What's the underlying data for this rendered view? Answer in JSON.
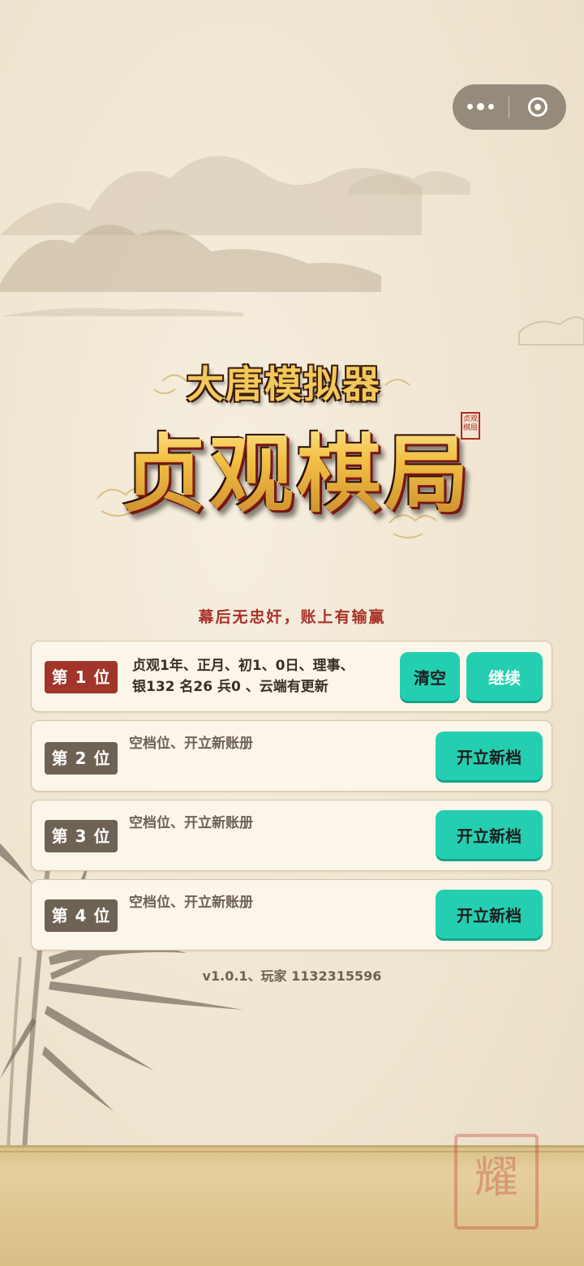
{
  "capsule": {
    "more_icon": "more-dots-icon",
    "close_icon": "target-icon"
  },
  "logo": {
    "subtitle": "大唐模拟器",
    "title": "贞观棋局",
    "stamp": "贞观 棋局"
  },
  "slogan": "幕后无忠奸，账上有输赢",
  "slots": [
    {
      "badge": "第 1 位",
      "line1": "贞观1年、正月、初1、0日、理事、",
      "line2": "银132 名26 兵0 、云端有更新",
      "clear_label": "清空",
      "continue_label": "继续"
    },
    {
      "badge": "第 2 位",
      "text": "空档位、开立新账册",
      "button_label": "开立新档"
    },
    {
      "badge": "第 3 位",
      "text": "空档位、开立新账册",
      "button_label": "开立新档"
    },
    {
      "badge": "第 4 位",
      "text": "空档位、开立新账册",
      "button_label": "开立新档"
    }
  ],
  "footer": "v1.0.1、玩家 1132315596",
  "seal_bottom": "耀",
  "colors": {
    "accent_teal": "#24cfb1",
    "badge_red": "#a2342b",
    "badge_grey": "#6e6255",
    "slogan_red": "#a8322a"
  }
}
